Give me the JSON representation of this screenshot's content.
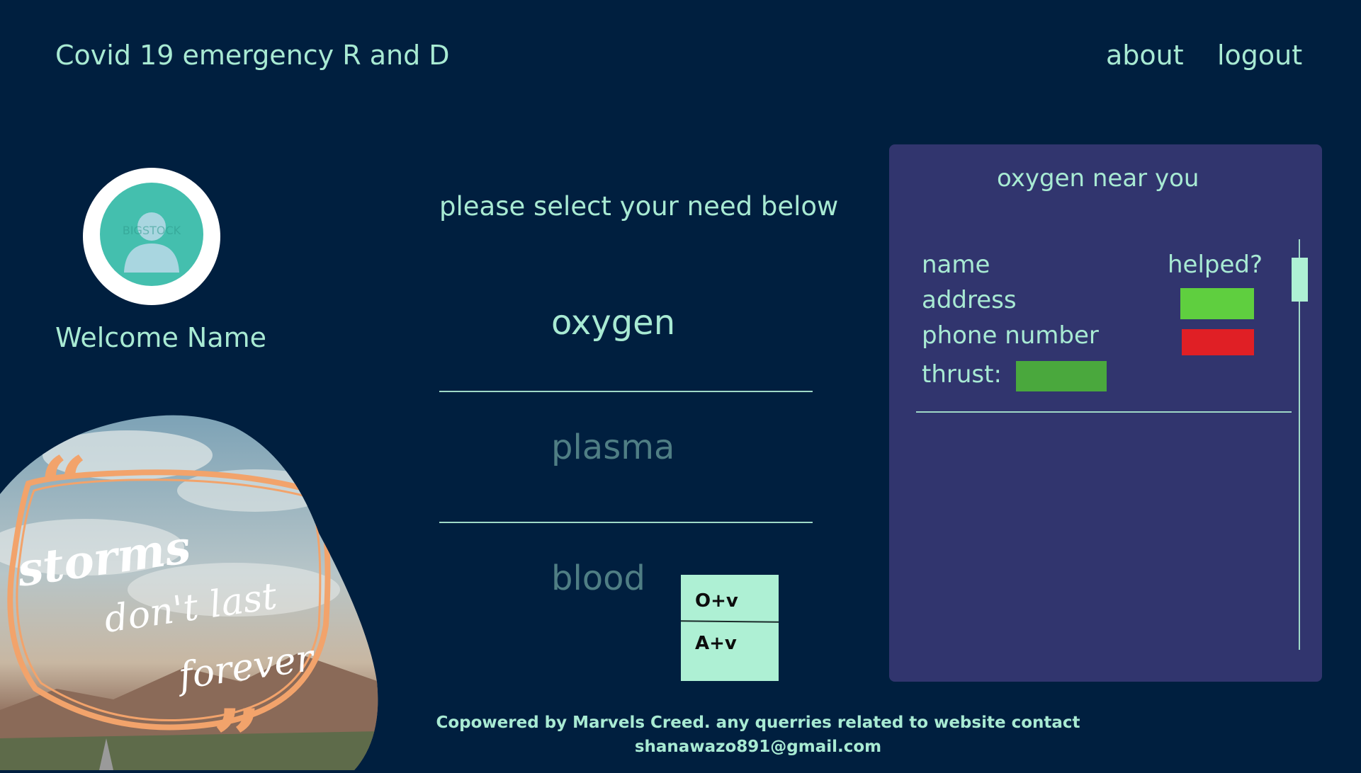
{
  "header": {
    "brand": "Covid 19 emergency R and D",
    "nav": {
      "about": "about",
      "logout": "logout"
    }
  },
  "user": {
    "welcome": "Welcome Name",
    "avatar_watermark": "BIGSTOCK"
  },
  "quote": {
    "line1": "storms",
    "line2": "don't last",
    "line3": "forever"
  },
  "center": {
    "prompt": "please select your need below",
    "needs": [
      "oxygen",
      "plasma",
      "blood"
    ],
    "blood_groups": [
      "O+v",
      "A+v"
    ]
  },
  "panel": {
    "title": "oxygen near you",
    "labels": {
      "name": "name",
      "address": "address",
      "phone": "phone number",
      "thrust": "thrust:",
      "helped": "helped?"
    }
  },
  "footer": {
    "text": "Copowered by Marvels Creed. any querries related to website contact",
    "email": "shanawazo891@gmail.com"
  },
  "colors": {
    "background": "#001f3f",
    "accent": "#a8ead3",
    "panel": "#31356e",
    "yes": "#5fcf3f",
    "no": "#e01f25",
    "thrust": "#4aa83d",
    "inactive": "#4f7e84"
  }
}
